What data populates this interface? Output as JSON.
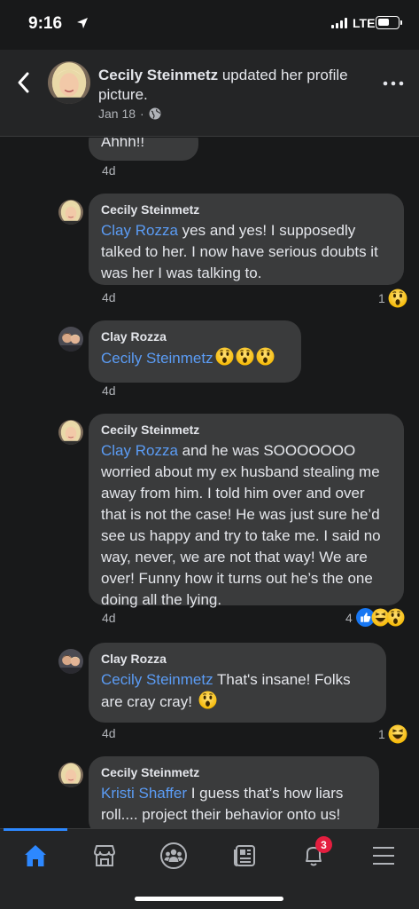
{
  "status_bar": {
    "time": "9:16",
    "network": "LTE"
  },
  "header": {
    "author": "Cecily Steinmetz",
    "action": "updated her profile picture.",
    "date": "Jan 18",
    "privacy_icon": "globe-icon"
  },
  "comments": [
    {
      "name": "",
      "text": "Ahhh!!",
      "time": "4d",
      "reaction_count": "",
      "reactions": []
    },
    {
      "name": "Cecily Steinmetz",
      "mention": "Clay Rozza",
      "text": " yes and yes! I supposedly talked to her. I now have serious doubts it was her I was talking to.",
      "time": "4d",
      "reaction_count": "1",
      "reactions": [
        "wow"
      ]
    },
    {
      "name": "Clay Rozza",
      "mention": "Cecily Steinmetz",
      "text": "",
      "inline_emojis": [
        "wow",
        "wow",
        "wow"
      ],
      "time": "4d",
      "reaction_count": "",
      "reactions": []
    },
    {
      "name": "Cecily Steinmetz",
      "mention": "Clay Rozza",
      "text": " and he was SOOOOOOO worried about my ex husband stealing me away from him. I told him over and over that is not the case! He was just sure he’d see us happy and try to take me. I said no way, never, we are not that way! We are over! Funny how it turns out he’s the one doing all the lying.",
      "time": "4d",
      "reaction_count": "4",
      "reactions": [
        "like",
        "haha",
        "wow"
      ]
    },
    {
      "name": "Clay Rozza",
      "mention": "Cecily Steinmetz",
      "text": " That's insane! Folks are cray cray! ",
      "inline_emojis": [
        "wow"
      ],
      "time": "4d",
      "reaction_count": "1",
      "reactions": [
        "haha"
      ]
    },
    {
      "name": "Cecily Steinmetz",
      "mention": "Kristi Shaffer",
      "text": " I guess that’s how liars roll.... project their behavior onto us!",
      "time": "",
      "reaction_count": "",
      "reactions": []
    }
  ],
  "tabbar": {
    "items": [
      "home-icon",
      "marketplace-icon",
      "groups-icon",
      "news-icon",
      "notifications-icon",
      "menu-icon"
    ],
    "notification_badge": "3"
  },
  "colors": {
    "background": "#18191a",
    "bubble": "#3a3b3c",
    "mention": "#5b9cf5",
    "accent": "#2d88ff",
    "badge": "#e41e3f"
  }
}
